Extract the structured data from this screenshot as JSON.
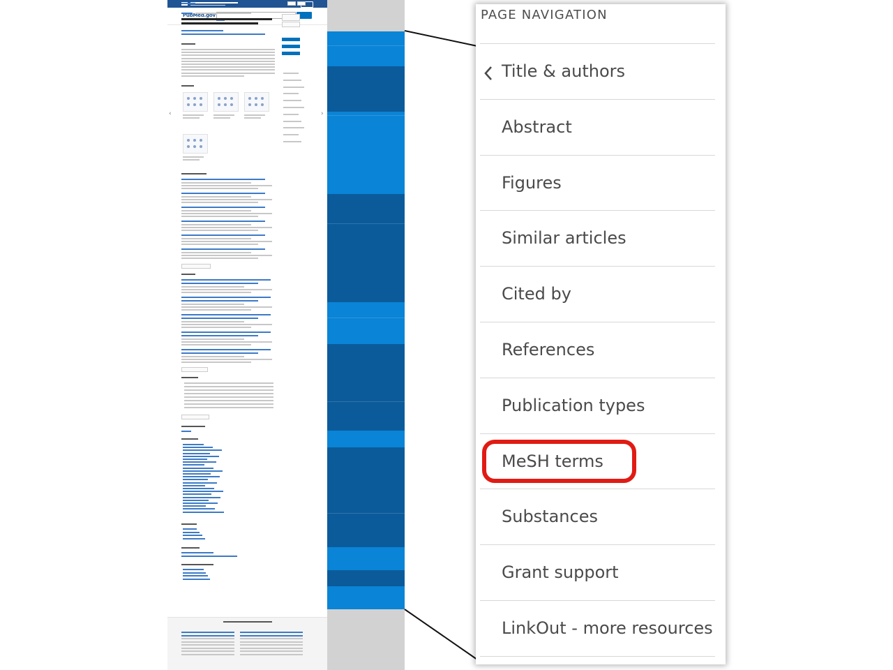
{
  "panel": {
    "title": "PAGE NAVIGATION",
    "items": [
      {
        "label": "Title & authors",
        "active": true
      },
      {
        "label": "Abstract"
      },
      {
        "label": "Figures"
      },
      {
        "label": "Similar articles"
      },
      {
        "label": "Cited by"
      },
      {
        "label": "References"
      },
      {
        "label": "Publication types"
      },
      {
        "label": "MeSH terms",
        "highlighted": true
      },
      {
        "label": "Substances"
      },
      {
        "label": "Grant support"
      },
      {
        "label": "LinkOut - more resources"
      }
    ]
  },
  "thumbnail": {
    "logo": "PubMed.gov",
    "article_title": "Influenza Virus RNA Polymerase: Insights into the Mechanisms of Viral RNA Synthesis",
    "sections": [
      "Abstract",
      "Figures",
      "Similar articles",
      "Cited by",
      "References",
      "Publication types",
      "MeSH terms",
      "Substances",
      "Grant support",
      "LinkOut - more resources"
    ]
  },
  "colors": {
    "highlight": "#e01b14",
    "minimap_light": "#0a84d6",
    "minimap_dark": "#0b5b9b",
    "pubmed_blue": "#205493"
  },
  "icons": {
    "back": "chevron-left-icon"
  }
}
